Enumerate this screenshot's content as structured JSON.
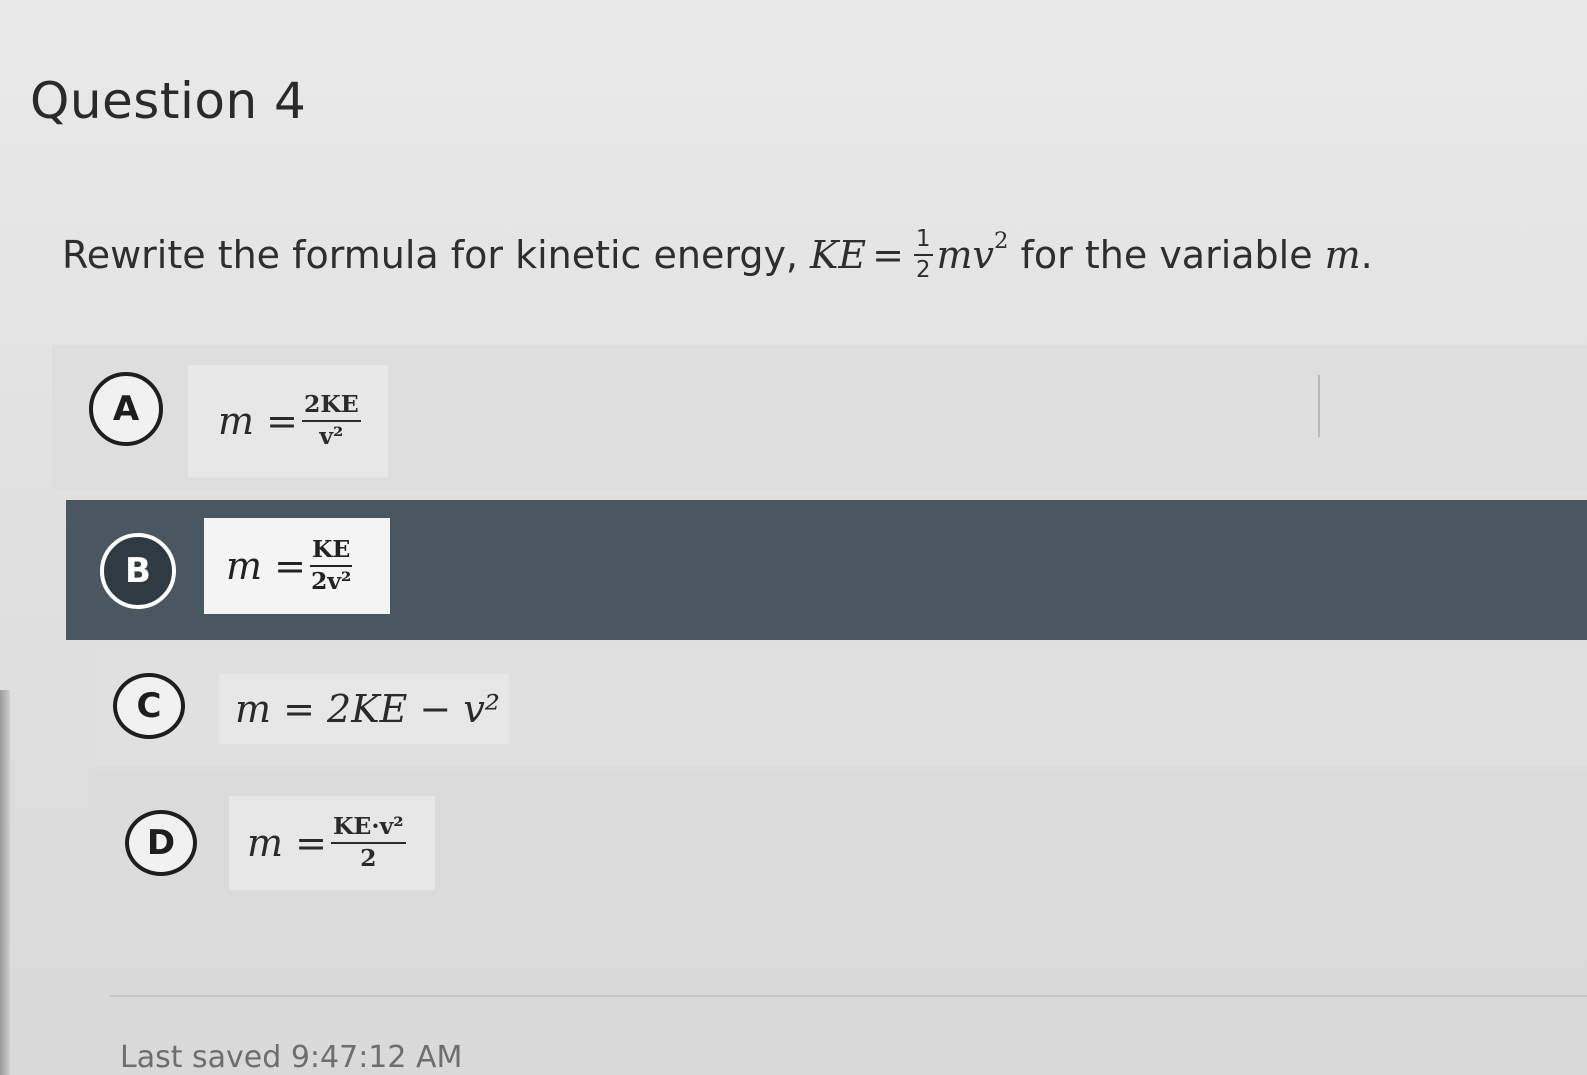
{
  "question": {
    "title": "Question 4",
    "prompt_before": "Rewrite the formula for kinetic energy,",
    "formula_lhs": "KE",
    "formula_eq": "=",
    "formula_frac_num": "1",
    "formula_frac_den": "2",
    "formula_rest": "mv",
    "formula_exp": "2",
    "prompt_after": "for the variable",
    "variable": "m",
    "period": "."
  },
  "choices": [
    {
      "letter": "A",
      "lhs": "m =",
      "num": "2KE",
      "den": "v²",
      "selected": false
    },
    {
      "letter": "B",
      "lhs": "m =",
      "num": "KE",
      "den": "2v²",
      "selected": true
    },
    {
      "letter": "C",
      "expr": "m = 2KE − v²",
      "selected": false
    },
    {
      "letter": "D",
      "lhs": "m =",
      "num": "KE·v²",
      "den": "2",
      "selected": false
    }
  ],
  "footer": {
    "status_text": "Last saved 9:47:12 AM"
  },
  "colors": {
    "selected_bg": "#4a5660",
    "page_bg": "#e4e4e4"
  }
}
